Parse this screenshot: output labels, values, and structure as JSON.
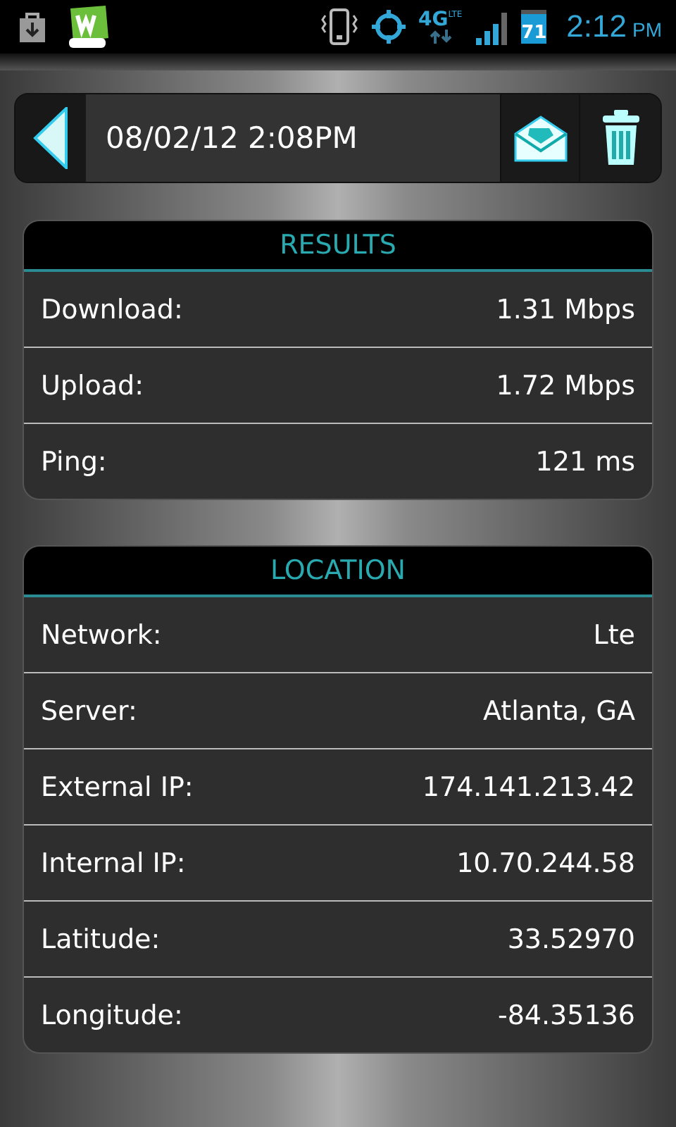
{
  "status_bar": {
    "network": "4G",
    "network_sub": "LTE",
    "battery": "71",
    "time": "2:12",
    "ampm": "PM"
  },
  "toolbar": {
    "title": "08/02/12 2:08PM"
  },
  "sections": [
    {
      "title": "RESULTS",
      "rows": [
        {
          "label": "Download:",
          "value": "1.31 Mbps"
        },
        {
          "label": "Upload:",
          "value": "1.72 Mbps"
        },
        {
          "label": "Ping:",
          "value": "121 ms"
        }
      ]
    },
    {
      "title": "LOCATION",
      "rows": [
        {
          "label": "Network:",
          "value": "Lte"
        },
        {
          "label": "Server:",
          "value": "Atlanta, GA"
        },
        {
          "label": "External IP:",
          "value": "174.141.213.42"
        },
        {
          "label": "Internal IP:",
          "value": "10.70.244.58"
        },
        {
          "label": "Latitude:",
          "value": "33.52970"
        },
        {
          "label": "Longitude:",
          "value": "-84.35136"
        }
      ]
    }
  ]
}
